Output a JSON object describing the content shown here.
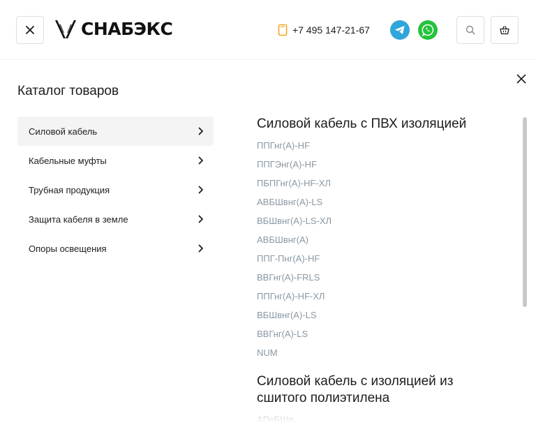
{
  "header": {
    "logo_text": "СНАБЭКС",
    "phone": "+7 495 147-21-67"
  },
  "icons": {
    "close": "close-icon",
    "logo": "logo-icon",
    "phone": "phone-icon",
    "telegram": "telegram-icon",
    "whatsapp": "whatsapp-icon",
    "search": "search-icon",
    "cart": "cart-icon",
    "chevron": "chevron-right-icon"
  },
  "colors": {
    "accent": "#f5a623",
    "telegram": "#2fa6da",
    "whatsapp": "#25c33c",
    "link": "#8a98a4",
    "active_bg": "#f4f4f4"
  },
  "catalog": {
    "title": "Каталог товаров",
    "categories": [
      {
        "label": "Силовой кабель",
        "active": true
      },
      {
        "label": "Кабельные муфты",
        "active": false
      },
      {
        "label": "Трубная продукция",
        "active": false
      },
      {
        "label": "Защита кабеля в земле",
        "active": false
      },
      {
        "label": "Опоры освещения",
        "active": false
      }
    ]
  },
  "submenu": {
    "groups": [
      {
        "title": "Силовой кабель с ПВХ изоляцией",
        "items": [
          "ППГнг(А)-HF",
          "ППГЭнг(А)-HF",
          "ПБПГнг(А)-HF-ХЛ",
          "АВБШвнг(А)-LS",
          "ВБШвнг(А)-LS-ХЛ",
          "АВБШвнг(А)",
          "ППГ-Пнг(А)-HF",
          "ВВГнг(А)-FRLS",
          "ППГнг(А)-HF-ХЛ",
          "ВБШвнг(А)-LS",
          "ВВГнг(А)-LS",
          "NUM"
        ]
      },
      {
        "title": "Силовой кабель с изоляцией из сшитого полиэтилена",
        "items": [
          "АПвБШп"
        ]
      }
    ]
  }
}
